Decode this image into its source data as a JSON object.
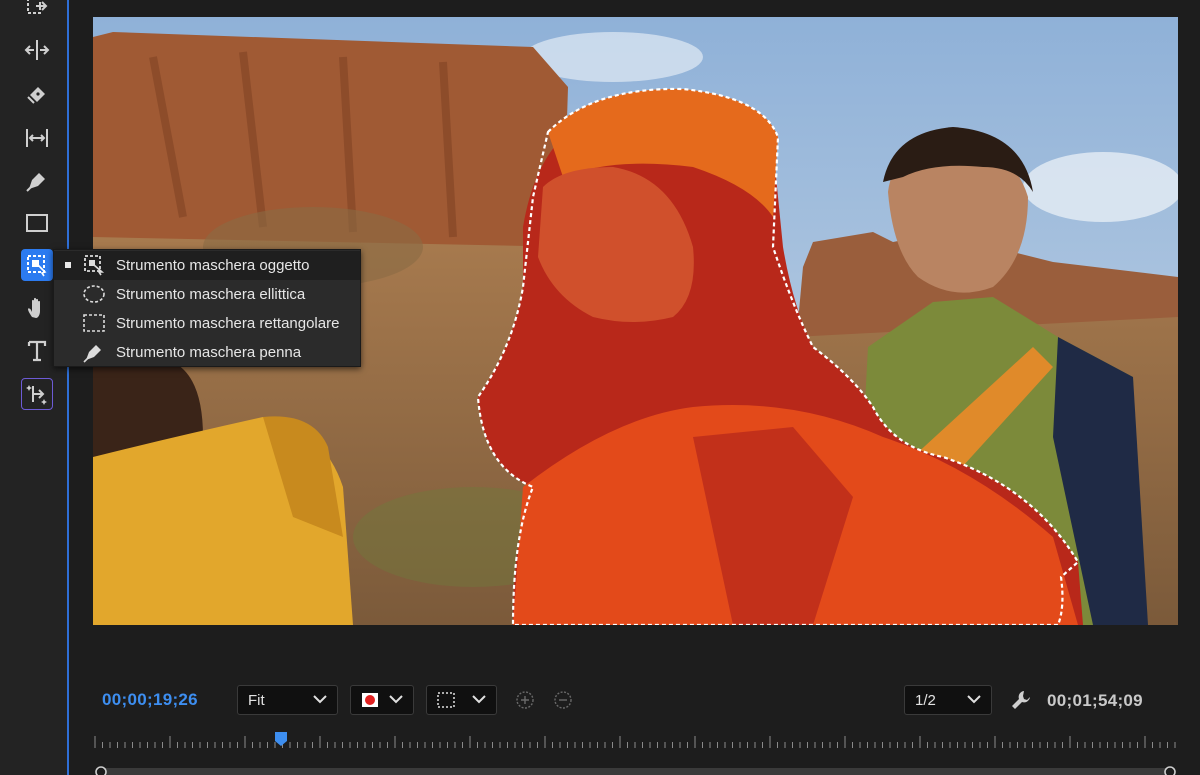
{
  "toolbar": {
    "tools": [
      {
        "name": "track-select-forward",
        "icon": "track-select-icon"
      },
      {
        "name": "ripple-edit",
        "icon": "ripple-edit-icon"
      },
      {
        "name": "razor",
        "icon": "razor-icon"
      },
      {
        "name": "slip",
        "icon": "slip-icon"
      },
      {
        "name": "pen",
        "icon": "pen-icon"
      },
      {
        "name": "rectangle",
        "icon": "rectangle-icon"
      },
      {
        "name": "object-mask",
        "icon": "object-mask-icon",
        "active": true
      },
      {
        "name": "hand",
        "icon": "hand-icon"
      },
      {
        "name": "type",
        "icon": "type-icon"
      },
      {
        "name": "generative-extend",
        "icon": "generative-extend-icon"
      }
    ],
    "accent_color": "#2c7bf0"
  },
  "flyout": {
    "items": [
      {
        "label": "Strumento maschera oggetto",
        "icon": "object-mask-icon",
        "selected": true
      },
      {
        "label": "Strumento maschera ellittica",
        "icon": "ellipse-mask-icon",
        "selected": false
      },
      {
        "label": "Strumento maschera rettangolare",
        "icon": "rectangle-mask-icon",
        "selected": false
      },
      {
        "label": "Strumento maschera penna",
        "icon": "pen-mask-icon",
        "selected": false
      }
    ]
  },
  "viewer": {
    "mask_overlay_color": "#e8341c",
    "mask_outline": "marching-ants"
  },
  "controls": {
    "current_timecode": "00;00;19;26",
    "zoom": "Fit",
    "mask_color_swatch": "#e02020",
    "safe_margins_icon": "dashed-rectangle-icon",
    "resolution": "1/2",
    "wrench_icon": "wrench-icon",
    "duration_timecode": "00;01;54;09",
    "timecode_color": "#3d8ef0"
  }
}
